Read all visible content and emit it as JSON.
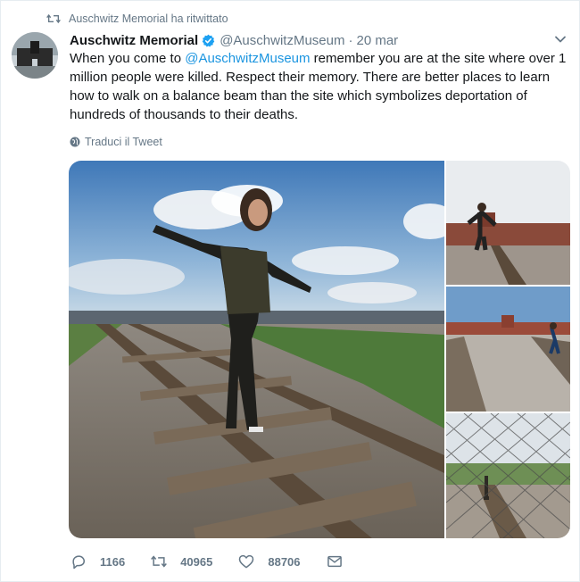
{
  "retweet_notice": "Auschwitz Memorial ha ritwittato",
  "tweet": {
    "display_name": "Auschwitz Memorial",
    "handle": "@AuschwitzMuseum",
    "separator": "·",
    "date": "20 mar",
    "text_prefix": "When you come to ",
    "mention": "@AuschwitzMuseum",
    "text_suffix": " remember you are at the  site where over 1 million people were killed. Respect their memory. There are better places to learn how to walk on a balance beam than the site which symbolizes deportation of hundreds of thousands to their deaths.",
    "translate_label": "Traduci il Tweet"
  },
  "actions": {
    "replies": "1166",
    "retweets": "40965",
    "likes": "88706"
  },
  "colors": {
    "accent": "#1b95e0",
    "muted": "#657786",
    "retweet_green": "#657786"
  },
  "icons": {
    "retweet": "retweet-icon",
    "verified": "verified-badge-icon",
    "chevron": "chevron-down-icon",
    "globe": "globe-icon",
    "reply": "reply-icon",
    "like": "heart-icon",
    "dm": "envelope-icon"
  }
}
